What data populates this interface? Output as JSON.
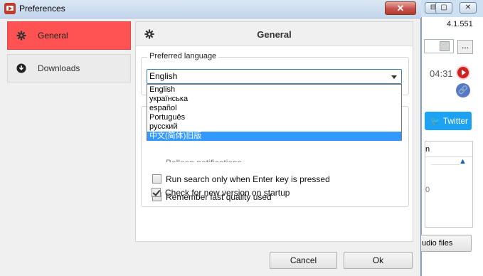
{
  "window": {
    "title": "Preferences",
    "close_label": "✕"
  },
  "sidebar": {
    "items": [
      {
        "label": "General",
        "icon": "gear-icon",
        "active": true
      },
      {
        "label": "Downloads",
        "icon": "download-icon",
        "active": false
      }
    ]
  },
  "panel": {
    "title": "General"
  },
  "language": {
    "legend": "Preferred language",
    "selected": "English",
    "options": [
      "English",
      "українська",
      "español",
      "Português",
      "русский",
      "中文(简体)旧版"
    ],
    "highlighted_index": 5
  },
  "options": {
    "partial_hidden": "Balloon notifications",
    "items": [
      {
        "label": "Run search only when Enter key is pressed",
        "checked": false
      },
      {
        "label": "Remember last quality used",
        "checked": false
      },
      {
        "label": "Check for new version on startup",
        "checked": true
      }
    ]
  },
  "buttons": {
    "cancel": "Cancel",
    "ok": "Ok"
  },
  "background_app": {
    "version": "4.1.551",
    "time": "04:31",
    "twitter_label": "Twitter",
    "more_label": "...",
    "table_header": "n",
    "table_tick": "0",
    "audio_button": "udio files",
    "controls": [
      "⊟",
      "▢",
      "✕"
    ]
  },
  "colors": {
    "accent": "#ff5252",
    "selection": "#3399ff",
    "twitter": "#1da1f2"
  }
}
